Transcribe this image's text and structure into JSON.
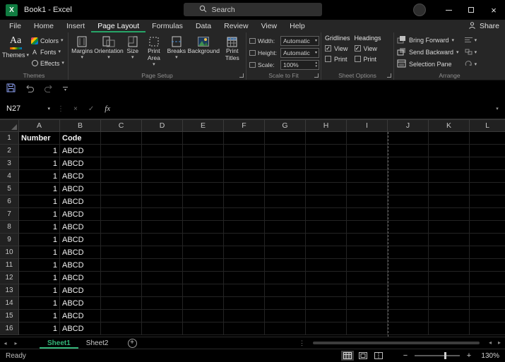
{
  "glyphs": {
    "chevron": "▾",
    "check": "✓",
    "cancel": "×",
    "dots_vertical": "⋮",
    "left_arrow": "◂",
    "right_arrow": "▸",
    "plus": "+",
    "minus": "−",
    "spinner_up": "▴",
    "spinner_down": "▾",
    "letter_a": "A",
    "aa": "Aa",
    "app_icon_letter": "X"
  },
  "titlebar": {
    "title": "Book1 - Excel",
    "search_placeholder": "Search"
  },
  "ribbon": {
    "tabs": [
      {
        "label": "File",
        "active": false
      },
      {
        "label": "Home",
        "active": false
      },
      {
        "label": "Insert",
        "active": false
      },
      {
        "label": "Page Layout",
        "active": true
      },
      {
        "label": "Formulas",
        "active": false
      },
      {
        "label": "Data",
        "active": false
      },
      {
        "label": "Review",
        "active": false
      },
      {
        "label": "View",
        "active": false
      },
      {
        "label": "Help",
        "active": false
      }
    ],
    "share": "Share"
  },
  "themes_group": {
    "label": "Themes",
    "themes_button": "Themes",
    "colors_button": "Colors",
    "fonts_button": "Fonts",
    "effects_button": "Effects"
  },
  "page_setup_group": {
    "label": "Page Setup",
    "margins": "Margins",
    "orientation": "Orientation",
    "size": "Size",
    "print_area": "Print Area",
    "breaks": "Breaks",
    "background": "Background",
    "print_titles": "Print Titles"
  },
  "scale_group": {
    "label": "Scale to Fit",
    "width_label": "Width:",
    "width_value": "Automatic",
    "height_label": "Height:",
    "height_value": "Automatic",
    "scale_label": "Scale:",
    "scale_value": "100%"
  },
  "sheet_options_group": {
    "label": "Sheet Options",
    "gridlines_title": "Gridlines",
    "headings_title": "Headings",
    "view_label": "View",
    "print_label": "Print",
    "gridlines_view_checked": true,
    "gridlines_print_checked": false,
    "headings_view_checked": true,
    "headings_print_checked": false
  },
  "arrange_group": {
    "label": "Arrange",
    "bring_forward": "Bring Forward",
    "send_backward": "Send Backward",
    "selection_pane": "Selection Pane"
  },
  "formula_bar": {
    "name_box": "N27",
    "fx": "fx",
    "value": ""
  },
  "grid": {
    "column_headers": [
      "A",
      "B",
      "C",
      "D",
      "E",
      "F",
      "G",
      "H",
      "I",
      "J",
      "K",
      "L"
    ],
    "page_break_after_column": "I",
    "rows": [
      {
        "n": "1",
        "A": "Number",
        "B": "Code",
        "bold": true
      },
      {
        "n": "2",
        "A": "1",
        "B": "ABCD"
      },
      {
        "n": "3",
        "A": "1",
        "B": "ABCD"
      },
      {
        "n": "4",
        "A": "1",
        "B": "ABCD"
      },
      {
        "n": "5",
        "A": "1",
        "B": "ABCD"
      },
      {
        "n": "6",
        "A": "1",
        "B": "ABCD"
      },
      {
        "n": "7",
        "A": "1",
        "B": "ABCD"
      },
      {
        "n": "8",
        "A": "1",
        "B": "ABCD"
      },
      {
        "n": "9",
        "A": "1",
        "B": "ABCD"
      },
      {
        "n": "10",
        "A": "1",
        "B": "ABCD"
      },
      {
        "n": "11",
        "A": "1",
        "B": "ABCD"
      },
      {
        "n": "12",
        "A": "1",
        "B": "ABCD"
      },
      {
        "n": "13",
        "A": "1",
        "B": "ABCD"
      },
      {
        "n": "14",
        "A": "1",
        "B": "ABCD"
      },
      {
        "n": "15",
        "A": "1",
        "B": "ABCD"
      },
      {
        "n": "16",
        "A": "1",
        "B": "ABCD"
      }
    ]
  },
  "sheet_bar": {
    "tabs": [
      {
        "label": "Sheet1",
        "active": true
      },
      {
        "label": "Sheet2",
        "active": false
      }
    ]
  },
  "status_bar": {
    "ready": "Ready",
    "zoom": "130%"
  },
  "colors": {
    "accent_green": "#27a567",
    "sheet_tab_green": "#33b579",
    "titlebar_bg": "#000000",
    "ribbon_bg": "#262626",
    "grid_bg": "#000000"
  }
}
